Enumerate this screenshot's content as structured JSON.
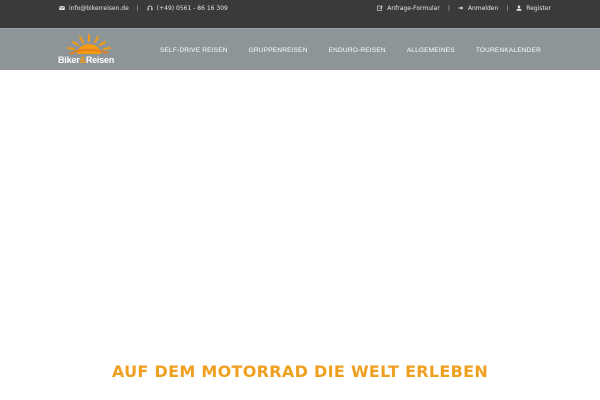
{
  "topbar": {
    "email": "info@bikerreisen.de",
    "phone": "(+49) 0561 - 86 16 309",
    "request_form": "Anfrage-Formular",
    "login": "Anmelden",
    "register": "Register",
    "separator": "|"
  },
  "logo": {
    "word1": "Biker",
    "amp": "&",
    "word2": "Reisen"
  },
  "menu": {
    "items": [
      {
        "label": "SELF-DRIVE REISEN"
      },
      {
        "label": "GRUPPENREISEN"
      },
      {
        "label": "ENDURO-REISEN"
      },
      {
        "label": "ALLGEMEINES"
      },
      {
        "label": "TOURENKALENDER"
      }
    ]
  },
  "headline": "AUF DEM MOTORRAD DIE WELT ERLEBEN",
  "colors": {
    "topbar_bg": "#3a3a3a",
    "navbar_bg": "#8d9598",
    "accent": "#f0a020"
  }
}
